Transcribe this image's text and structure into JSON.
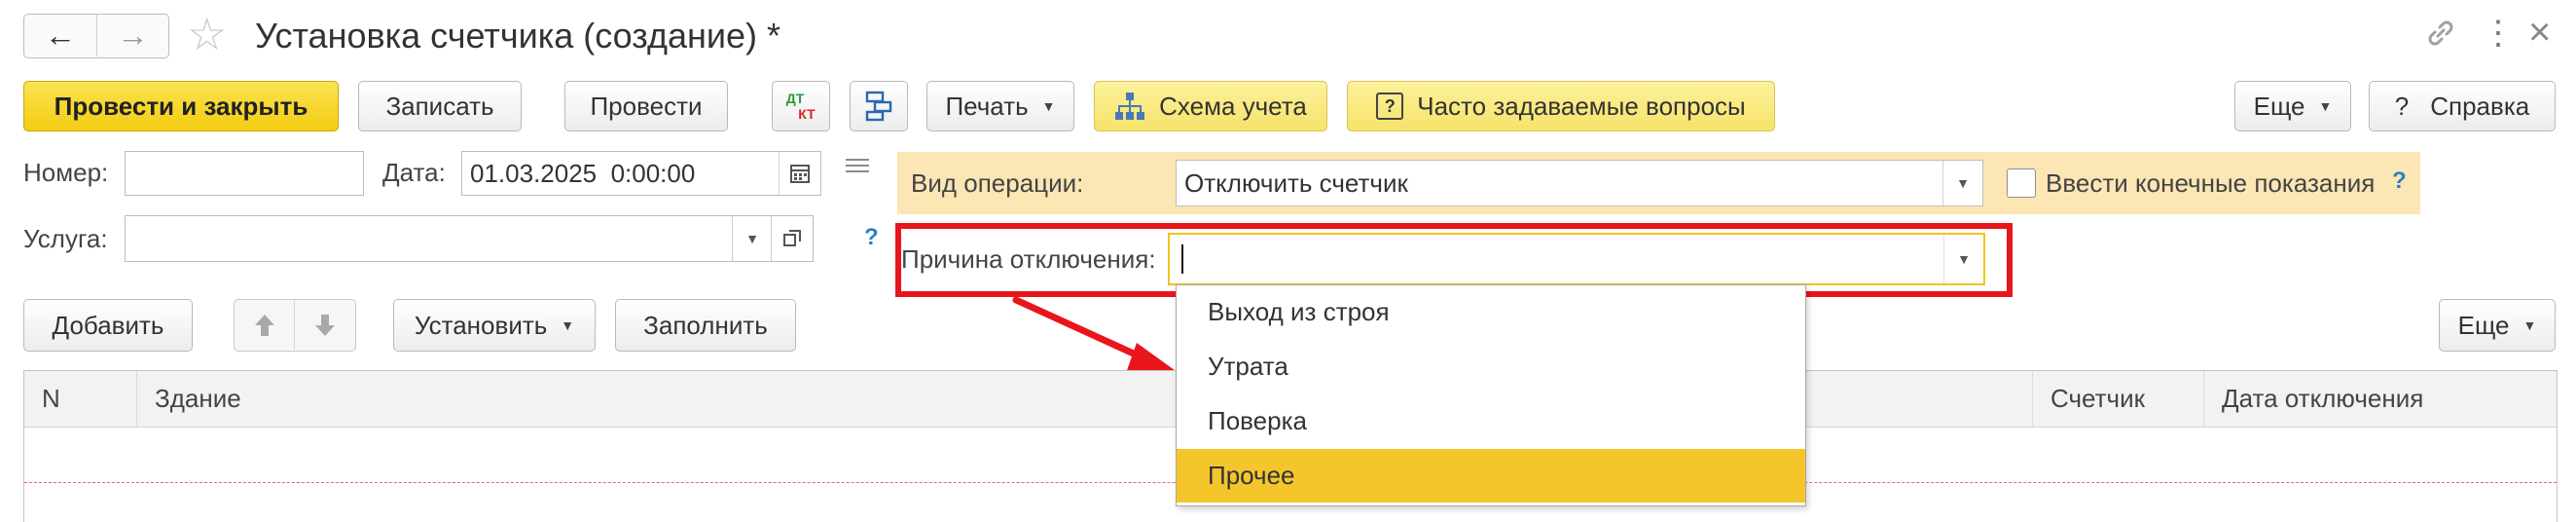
{
  "window": {
    "title": "Установка счетчика (создание) *"
  },
  "toolbar": {
    "post_close": "Провести и закрыть",
    "save": "Записать",
    "post": "Провести",
    "dtkt_top": "ДТ",
    "dtkt_bottom": "КТ",
    "print": "Печать",
    "scheme": "Схема учета",
    "faq": "Часто задаваемые вопросы",
    "more": "Еще",
    "help": "Справка",
    "help_q": "?"
  },
  "form": {
    "number_label": "Номер:",
    "number_value": "",
    "date_label": "Дата:",
    "date_value": "01.03.2025  0:00:00",
    "service_label": "Услуга:",
    "service_value": "",
    "operation_label": "Вид операции:",
    "operation_value": "Отключить счетчик",
    "final_readings_label": "Ввести конечные показания",
    "reason_label": "Причина отключения:",
    "reason_value": "",
    "help_mark": "?"
  },
  "dropdown": {
    "options": [
      "Выход из строя",
      "Утрата",
      "Поверка",
      "Прочее"
    ],
    "highlighted": "Прочее"
  },
  "table_toolbar": {
    "add": "Добавить",
    "set": "Установить",
    "fill": "Заполнить",
    "more": "Еще"
  },
  "table": {
    "columns": [
      "N",
      "Здание",
      "Счетчик",
      "Дата отключения"
    ]
  },
  "colors": {
    "accent_yellow": "#f3cc12",
    "highlight_red": "#e8151b",
    "operation_panel": "#fbe6b4",
    "selected_item": "#f5c62c"
  }
}
